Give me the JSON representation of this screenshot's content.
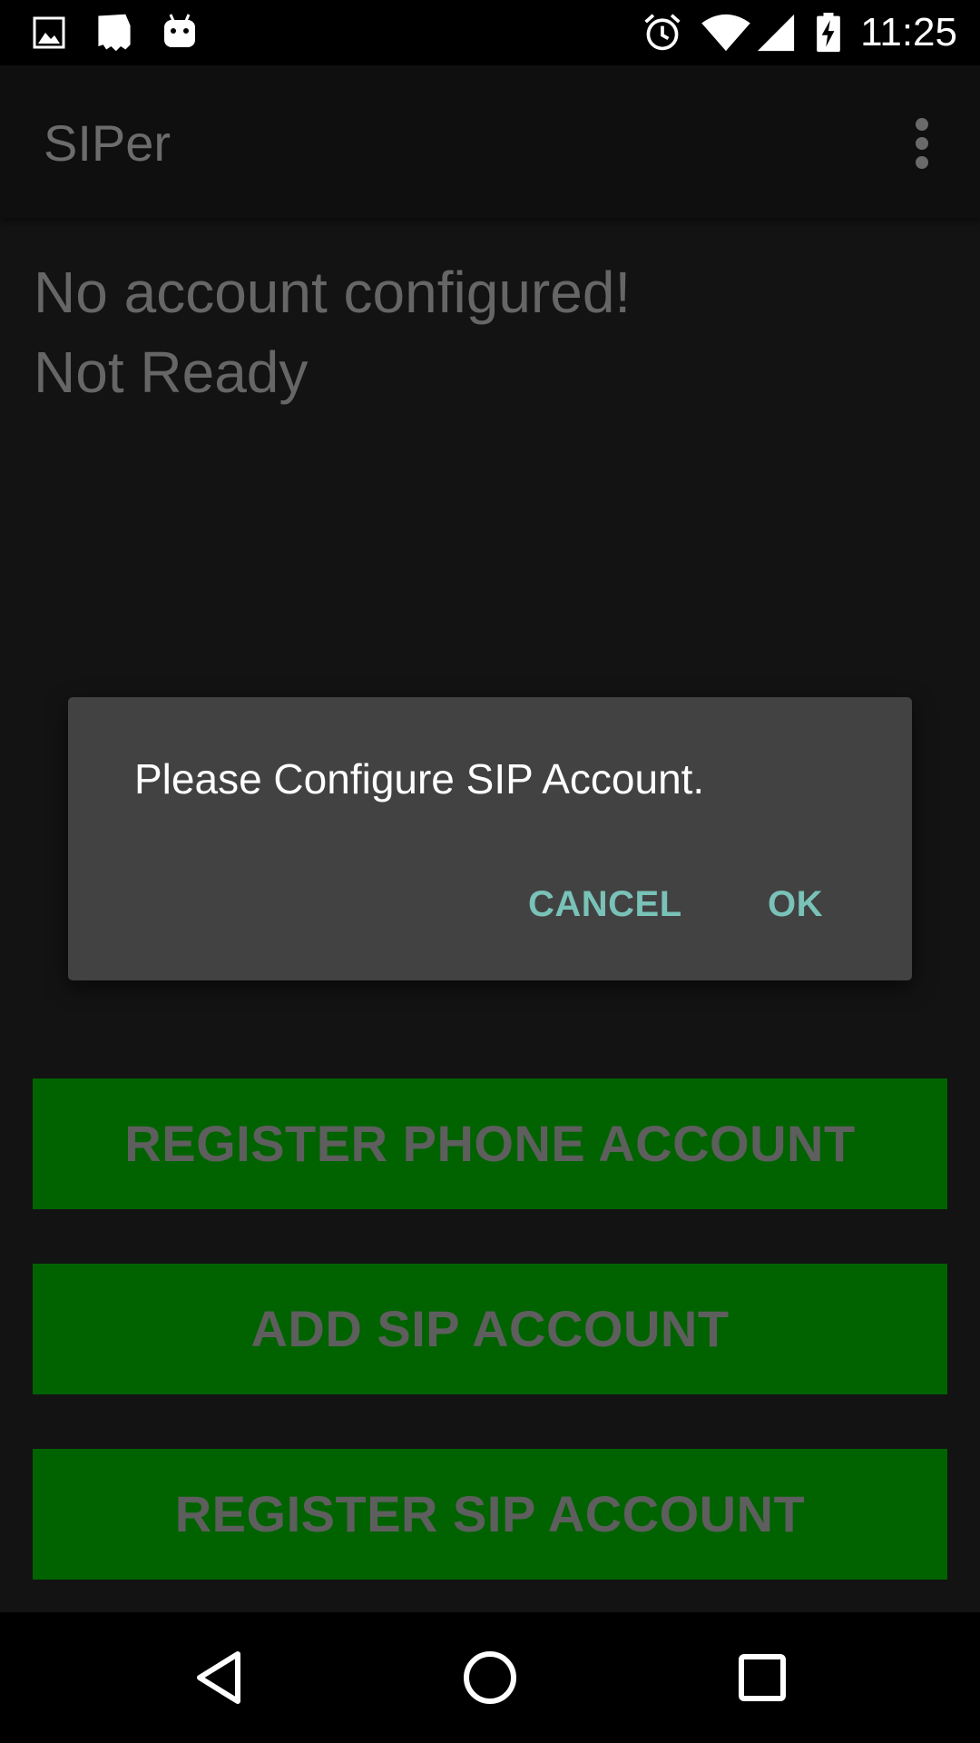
{
  "status_bar": {
    "time": "11:25",
    "left_icons": [
      "image-icon",
      "file-icon",
      "android-icon"
    ],
    "right_icons": [
      "alarm-icon",
      "wifi-icon",
      "signal-icon",
      "battery-charging-icon"
    ]
  },
  "app_bar": {
    "title": "SIPer",
    "menu_icon": "overflow-menu-icon"
  },
  "main": {
    "account_status": "No account configured!",
    "ready_status": "Not Ready"
  },
  "buttons": {
    "register_phone": "REGISTER PHONE ACCOUNT",
    "add_sip": "ADD SIP ACCOUNT",
    "register_sip": "REGISTER SIP ACCOUNT"
  },
  "dialog": {
    "message": "Please Configure SIP Account.",
    "cancel_label": "CANCEL",
    "ok_label": "OK"
  },
  "nav_bar": {
    "icons": [
      "back-icon",
      "home-icon",
      "recents-icon"
    ]
  },
  "colors": {
    "button_green": "#006300",
    "dialog_bg": "#424242",
    "dialog_accent": "#79c2b8",
    "background": "#131313"
  }
}
